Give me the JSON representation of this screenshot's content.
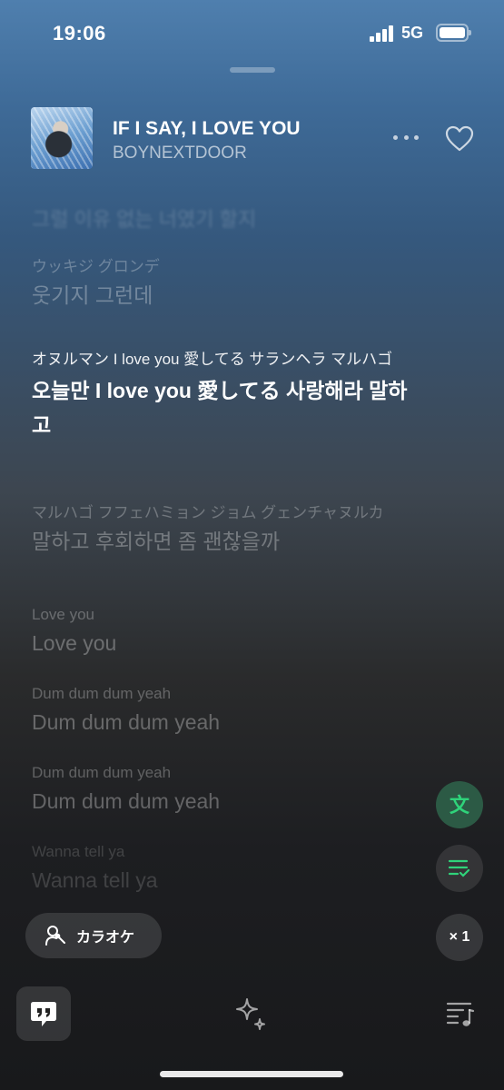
{
  "status_bar": {
    "time": "19:06",
    "network": "5G"
  },
  "track": {
    "title": "IF I SAY, I LOVE YOU",
    "artist": "BOYNEXTDOOR"
  },
  "lyrics": {
    "clipped_top": "그럴 이유 없는 너였기 할지",
    "lines": [
      {
        "reading": "ウッキジ グロンデ",
        "main": "웃기지 그런데",
        "state": "past"
      },
      {
        "reading": "オヌルマン I love you 愛してる サランヘラ マルハゴ",
        "main": "오늘만 I love you 愛してる 사랑해라 말하고",
        "state": "active"
      },
      {
        "reading": "マルハゴ フフェハミョン ジョム グェンチャヌルカ",
        "main": "말하고 후회하면 좀 괜찮을까",
        "state": "upcoming"
      },
      {
        "reading": "Love you",
        "main": "Love you",
        "state": "upcoming"
      },
      {
        "reading": "Dum dum dum yeah",
        "main": "Dum dum dum yeah",
        "state": "upcoming"
      },
      {
        "reading": "Dum dum dum yeah",
        "main": "Dum dum dum yeah",
        "state": "upcoming"
      },
      {
        "reading": "Wanna tell ya",
        "main": "Wanna tell ya",
        "state": "faded"
      }
    ]
  },
  "controls": {
    "karaoke_label": "カラオケ",
    "speed_label": "× 1",
    "translate_icon": "translate-icon",
    "queue_icon": "lyrics-queue-icon"
  },
  "colors": {
    "accent_green": "#2fd37a"
  }
}
